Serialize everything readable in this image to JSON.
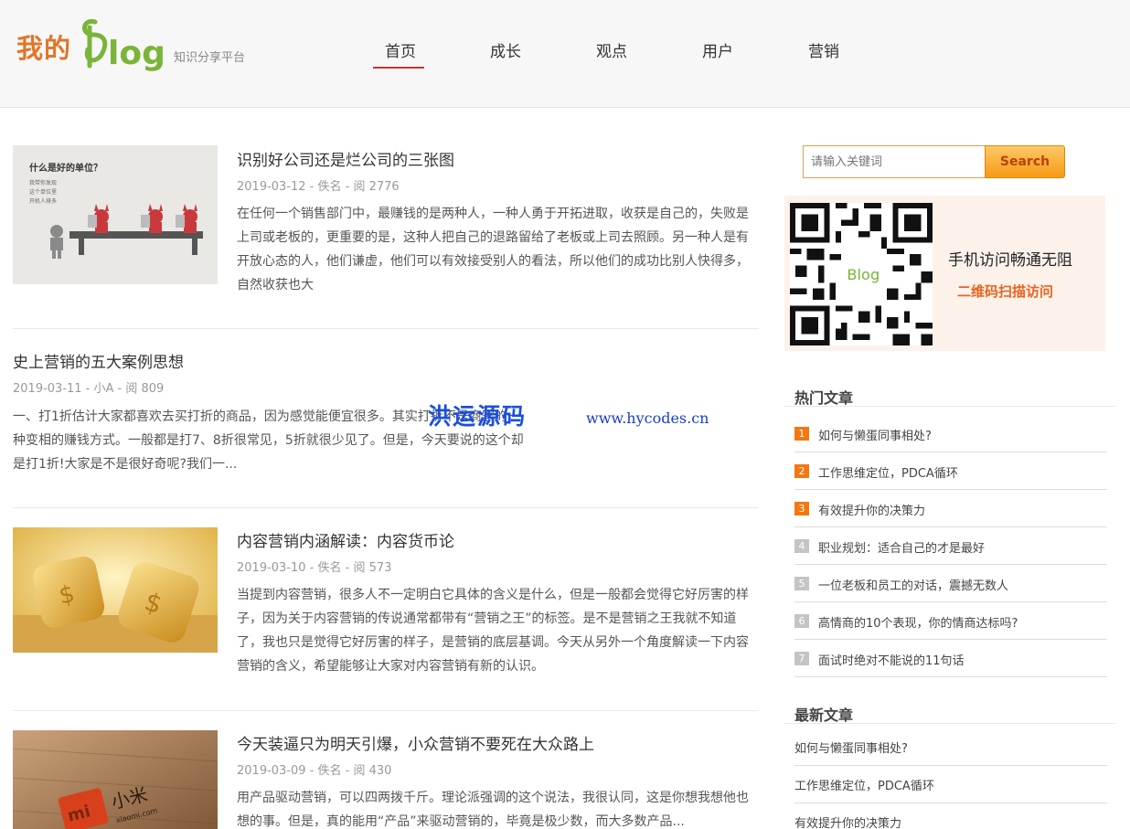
{
  "header": {
    "logo_cn": "我的",
    "logo_blog": "Blog",
    "tagline": "知识分享平台",
    "nav": [
      "首页",
      "成长",
      "观点",
      "用户",
      "营销"
    ],
    "active_nav": "首页"
  },
  "posts": [
    {
      "title": "识别好公司还是烂公司的三张图",
      "meta": "2019-03-12 - 佚名 - 阅 2776",
      "excerpt": "在任何一个销售部门中，最赚钱的是两种人，一种人勇于开拓进取，收获是自己的，失败是上司或老板的，更重要的是，这种人把自己的退路留给了老板或上司去照顾。另一种人是有开放心态的人，他们谦虚，他们可以有效接受别人的看法，所以他们的成功比别人快得多，自然收获也大",
      "thumb_text": [
        "什么是好的单位？",
        "我带你发现",
        "这个单位里",
        "开机人排多"
      ]
    },
    {
      "title": "史上营销的五大案例思想",
      "meta": "2019-03-11 - 小A - 阅 809",
      "excerpt": "一、打1折估计大家都喜欢去买打折的商品，因为感觉能便宜很多。其实打折不是商家的一种变相的赚钱方式。一般都是打7、8折很常见，5折就很少见了。但是，今天要说的这个却是打1折!大家是不是很好奇呢?我们一..."
    },
    {
      "title": "内容营销内涵解读：内容货币论",
      "meta": "2019-03-10 - 佚名 - 阅 573",
      "excerpt": "当提到内容营销，很多人不一定明白它具体的含义是什么，但是一般都会觉得它好厉害的样子，因为关于内容营销的传说通常都带有“营销之王”的标签。是不是营销之王我就不知道了，我也只是觉得它好厉害的样子，是营销的底层基调。今天从另外一个角度解读一下内容营销的含义，希望能够让大家对内容营销有新的认识。"
    },
    {
      "title": "今天装逼只为明天引爆，小众营销不要死在大众路上",
      "meta": "2019-03-09 - 佚名 - 阅 430",
      "excerpt": "用产品驱动营销，可以四两拨千斤。理论派强调的这个说法，我很认同，这是你想我想他也想的事。但是，真的能用“产品”来驱动营销的，毕竟是极少数，而大多数产品...",
      "thumb_text": [
        "小米",
        "xiaomi.com"
      ]
    }
  ],
  "sidebar": {
    "search_placeholder": "请输入关键词",
    "search_button": "Search",
    "qr_line1": "手机访问畅通无阻",
    "qr_line2": "二维码扫描访问",
    "hot_title": "热门文章",
    "hot": [
      {
        "num": "1",
        "label": "如何与懒蛋同事相处?"
      },
      {
        "num": "2",
        "label": "工作思维定位，PDCA循环"
      },
      {
        "num": "3",
        "label": "有效提升你的决策力"
      },
      {
        "num": "4",
        "label": "职业规划：适合自己的才是最好"
      },
      {
        "num": "5",
        "label": "一位老板和员工的对话，震撼无数人"
      },
      {
        "num": "6",
        "label": "高情商的10个表现，你的情商达标吗?"
      },
      {
        "num": "7",
        "label": "面试时绝对不能说的11句话"
      }
    ],
    "new_title": "最新文章",
    "new": [
      "如何与懒蛋同事相处?",
      "工作思维定位，PDCA循环",
      "有效提升你的决策力"
    ]
  },
  "watermark": {
    "cn": "洪运源码",
    "en": "www.hycodes.cn"
  },
  "colors": {
    "accent": "#f5770f",
    "nav_underline": "#c0392b",
    "logo_green": "#7ab43a",
    "logo_orange": "#e0762a"
  }
}
